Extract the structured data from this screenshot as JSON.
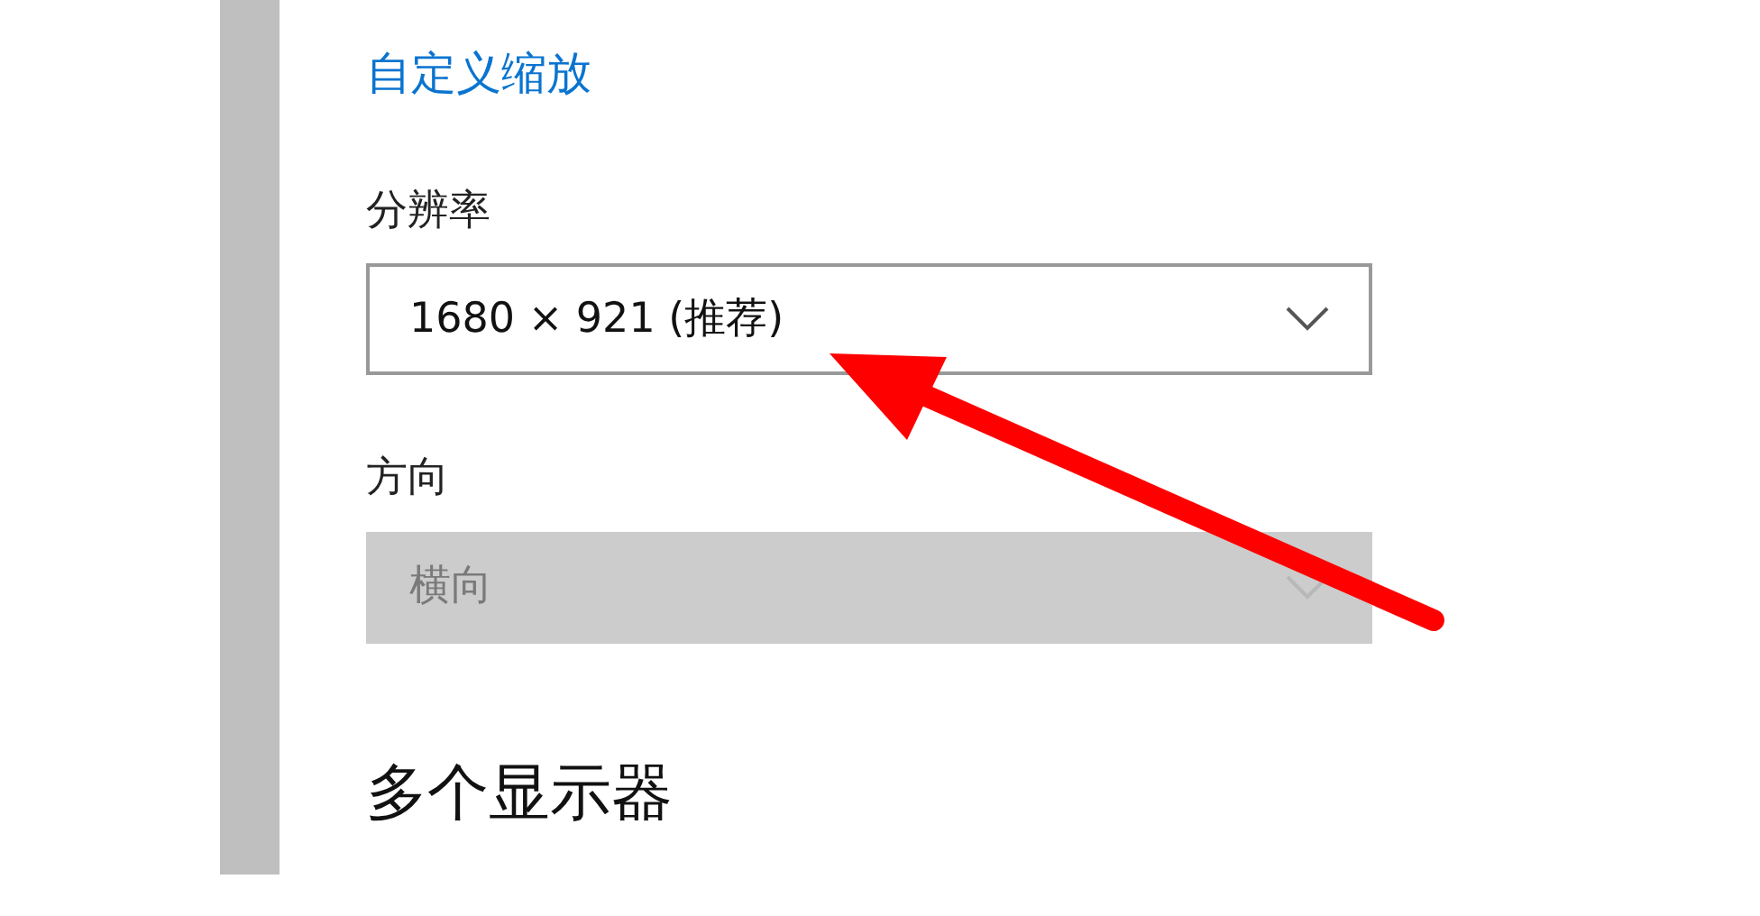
{
  "custom_scaling_link": "自定义缩放",
  "resolution": {
    "label": "分辨率",
    "value": "1680 × 921 (推荐)",
    "disabled": false
  },
  "orientation": {
    "label": "方向",
    "value": "横向",
    "disabled": true
  },
  "multiple_displays_heading": "多个显示器"
}
